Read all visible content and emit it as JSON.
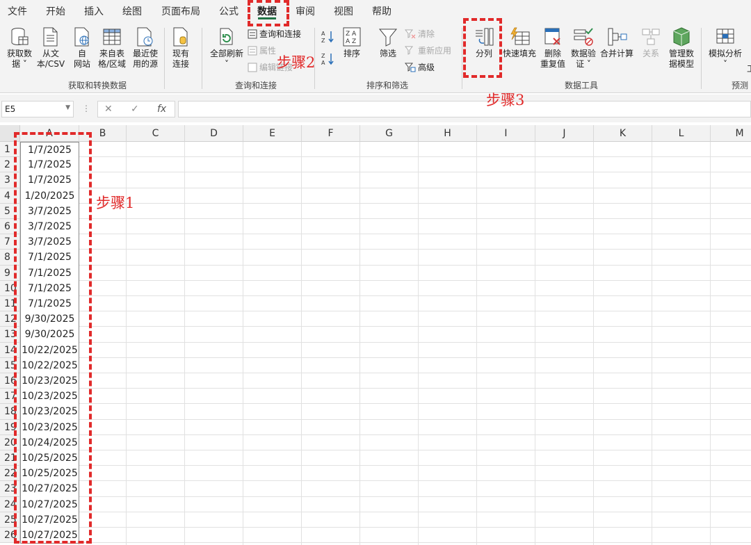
{
  "menu": {
    "tabs": [
      "文件",
      "开始",
      "插入",
      "绘图",
      "页面布局",
      "公式",
      "数据",
      "审阅",
      "视图",
      "帮助"
    ],
    "active": "数据"
  },
  "ribbon": {
    "get_data": "获取数\n据 ˅",
    "from_text_csv": "从文\n本/CSV",
    "from_web": "自\n网站",
    "from_table": "来自表\n格/区域",
    "recent_sources": "最近使\n用的源",
    "existing_conn": "现有\n连接",
    "group_get_transform": "获取和转换数据",
    "refresh_all": "全部刷新\n˅",
    "queries_conn": "查询和连接",
    "properties": "属性",
    "edit_links": "编辑链接",
    "group_queries": "查询和连接",
    "sort_az": "A↓Z",
    "sort_za": "Z↓A",
    "sort": "排序",
    "filter": "筛选",
    "clear": "清除",
    "reapply": "重新应用",
    "advanced": "高级",
    "group_sort_filter": "排序和筛选",
    "text_to_columns": "分列",
    "flash_fill": "快速填充",
    "remove_duplicates": "删除\n重复值",
    "data_validation": "数据验\n证 ˅",
    "consolidate": "合并计算",
    "relationships": "关系",
    "data_model": "管理数\n据模型",
    "group_data_tools": "数据工具",
    "what_if": "模拟分析\n˅",
    "group_forecast": "预测",
    "forecast_sheet_partial": "工"
  },
  "formula_bar": {
    "name_box": "E5",
    "cancel_icon": "✕",
    "enter_icon": "✓",
    "fx_icon": "fx",
    "formula": ""
  },
  "columns": [
    "A",
    "B",
    "C",
    "D",
    "E",
    "F",
    "G",
    "H",
    "I",
    "J",
    "K",
    "L",
    "M"
  ],
  "rows": [
    "1",
    "2",
    "3",
    "4",
    "5",
    "6",
    "7",
    "8",
    "9",
    "10",
    "11",
    "12",
    "13",
    "14",
    "15",
    "16",
    "17",
    "18",
    "19",
    "20",
    "21",
    "22",
    "23",
    "24",
    "25",
    "26"
  ],
  "cellsA": [
    "1/7/2025",
    "1/7/2025",
    "1/7/2025",
    "1/20/2025",
    "3/7/2025",
    "3/7/2025",
    "3/7/2025",
    "7/1/2025",
    "7/1/2025",
    "7/1/2025",
    "7/1/2025",
    "9/30/2025",
    "9/30/2025",
    "10/22/2025",
    "10/22/2025",
    "10/23/2025",
    "10/23/2025",
    "10/23/2025",
    "10/23/2025",
    "10/24/2025",
    "10/25/2025",
    "10/25/2025",
    "10/27/2025",
    "10/27/2025",
    "10/27/2025",
    "10/27/2025"
  ],
  "annotations": {
    "step1": "步骤1",
    "step2": "步骤2",
    "step3": "步骤3"
  },
  "colors": {
    "accent": "#217346",
    "annotation": "#e12a2a"
  }
}
